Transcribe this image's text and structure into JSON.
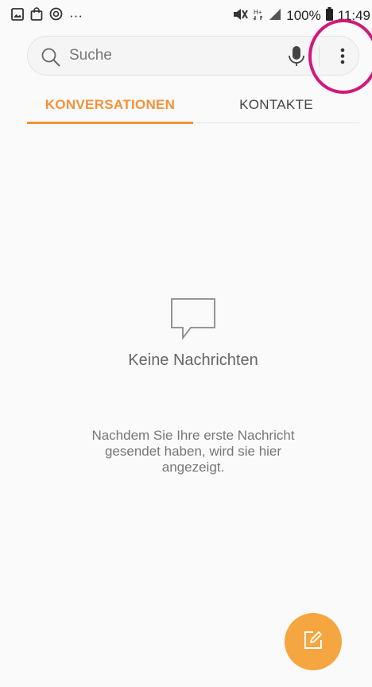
{
  "status_bar": {
    "left_more": "···",
    "battery": "100%",
    "time": "11:49",
    "network": "H+"
  },
  "search": {
    "placeholder": "Suche"
  },
  "tabs": [
    {
      "label": "KONVERSATIONEN",
      "active": true
    },
    {
      "label": "KONTAKTE",
      "active": false
    }
  ],
  "empty_state": {
    "title": "Keine Nachrichten",
    "description": "Nachdem Sie Ihre erste Nachricht gesendet haben, wird sie hier angezeigt."
  },
  "colors": {
    "accent": "#f3923b",
    "fab": "#f5a640",
    "annotation": "#d4177a"
  }
}
